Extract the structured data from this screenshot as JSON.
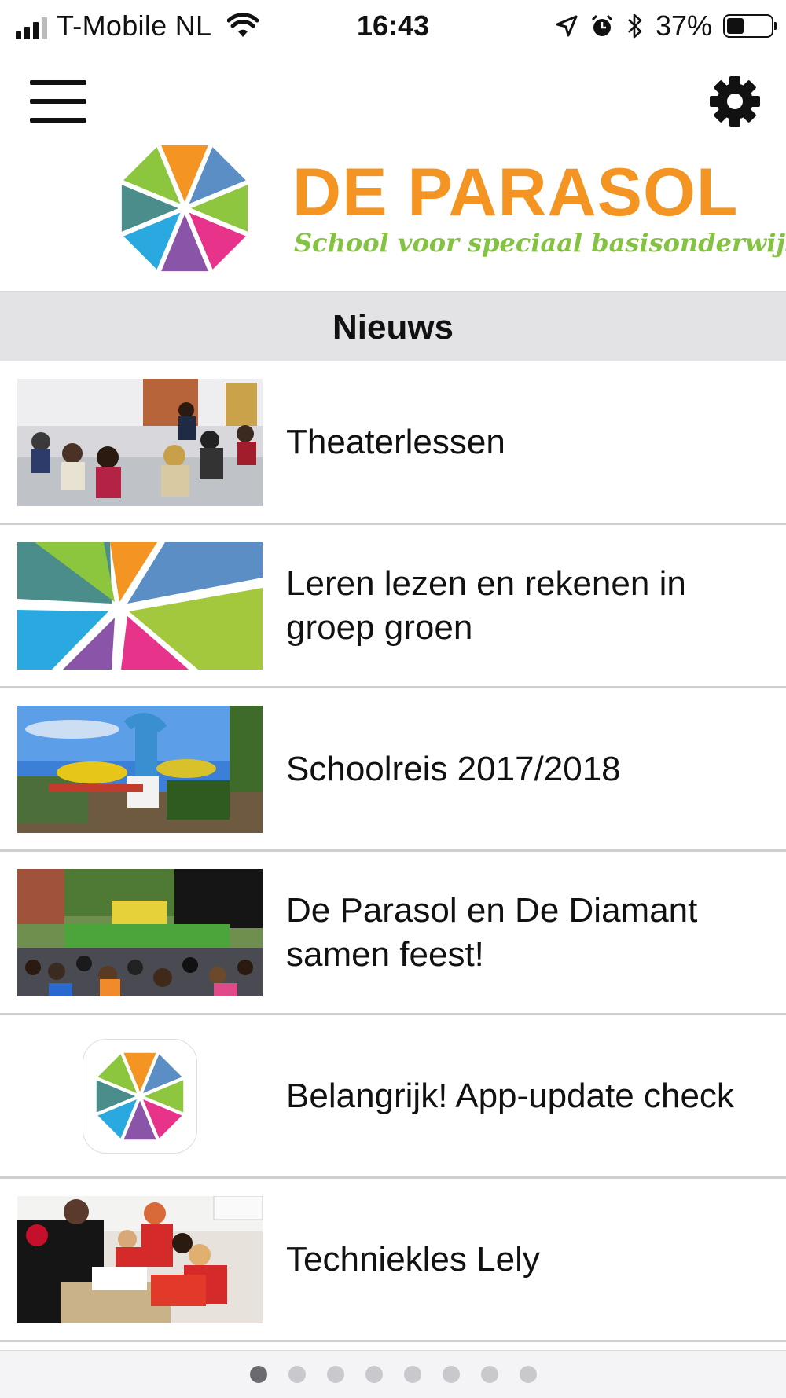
{
  "status_bar": {
    "carrier": "T-Mobile NL",
    "time": "16:43",
    "battery_percent": "37%",
    "battery_level": 0.37,
    "icons": [
      "signal-icon",
      "wifi-icon",
      "location-arrow-icon",
      "alarm-icon",
      "bluetooth-icon",
      "battery-icon"
    ]
  },
  "header": {
    "menu_icon": "hamburger-icon",
    "settings_icon": "gear-icon",
    "logo_title": "DE PARASOL",
    "logo_subtitle": "School voor speciaal basisonderwijs"
  },
  "colors": {
    "brand_orange": "#f39423",
    "brand_green": "#84c341",
    "parasol_segments": [
      "#f39423",
      "#5b8ec4",
      "#8fc640",
      "#e8338b",
      "#8a55a8",
      "#2aa9e0",
      "#4b8d8a",
      "#8cc63f"
    ]
  },
  "section": {
    "title": "Nieuws"
  },
  "news": [
    {
      "title": "Theaterlessen",
      "thumb": "theater-photo"
    },
    {
      "title": "Leren lezen en rekenen in groep groen",
      "thumb": "parasol-graphic"
    },
    {
      "title": "Schoolreis 2017/2018",
      "thumb": "amusement-park-photo"
    },
    {
      "title": "De Parasol en De Diamant samen feest!",
      "thumb": "school-party-photo"
    },
    {
      "title": "Belangrijk! App-update check",
      "thumb": "app-icon"
    },
    {
      "title": "Techniekles Lely",
      "thumb": "technique-class-photo"
    }
  ],
  "pagination": {
    "pages": 8,
    "current": 1
  }
}
